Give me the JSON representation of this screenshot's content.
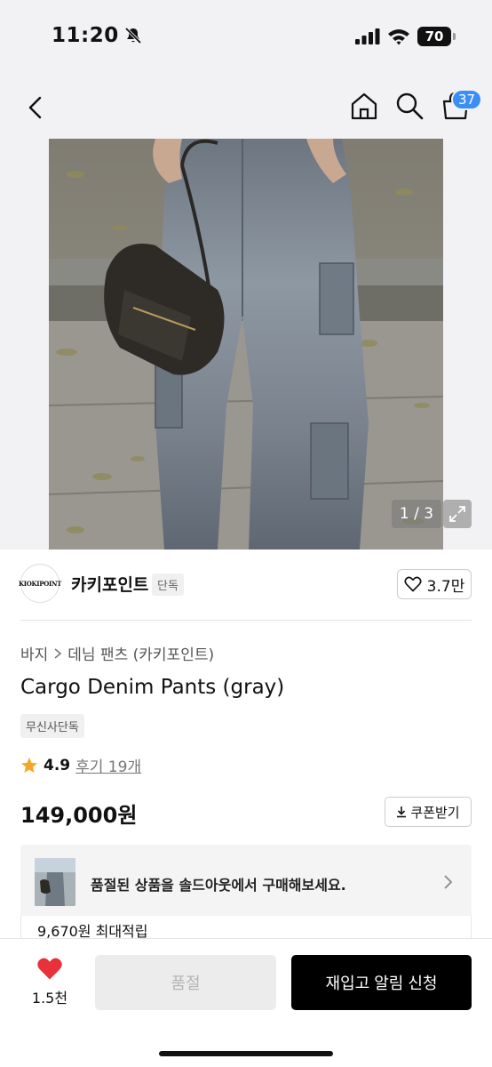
{
  "status_bar": {
    "time": "11:20",
    "battery": "70",
    "icons": [
      "bell-slash-icon",
      "signal-icon",
      "wifi-icon",
      "battery-icon"
    ]
  },
  "nav": {
    "icons": [
      "back-icon",
      "home-icon",
      "search-icon",
      "cart-icon"
    ],
    "cart_count": "37"
  },
  "gallery": {
    "pager": "1 / 3",
    "expand_icon": "expand-icon"
  },
  "brand": {
    "logo_text": "KIOKIPOINT",
    "name": "카키포인트",
    "tag": "단독",
    "likes": "3.7만"
  },
  "product": {
    "breadcrumb": [
      "바지",
      "데님 팬츠 (카키포인트)"
    ],
    "title": "Cargo Denim Pants (gray)",
    "exclusive_badge": "무신사단독",
    "rating": "4.9",
    "reviews": "후기 19개",
    "price": "149,000원",
    "coupon_label": "쿠폰받기"
  },
  "soldout_banner": {
    "text": "품절된 상품을 솔드아웃에서 구매해보세요."
  },
  "points": {
    "text": "9,670원 최대적립"
  },
  "bottom_bar": {
    "wish_count": "1.5천",
    "soldout_label": "품절",
    "restock_label": "재입고 알림 신청"
  },
  "colors": {
    "accent_badge": "#3a8ef6",
    "heart": "#e8313b",
    "star": "#f5a623",
    "primary_button": "#000000"
  }
}
